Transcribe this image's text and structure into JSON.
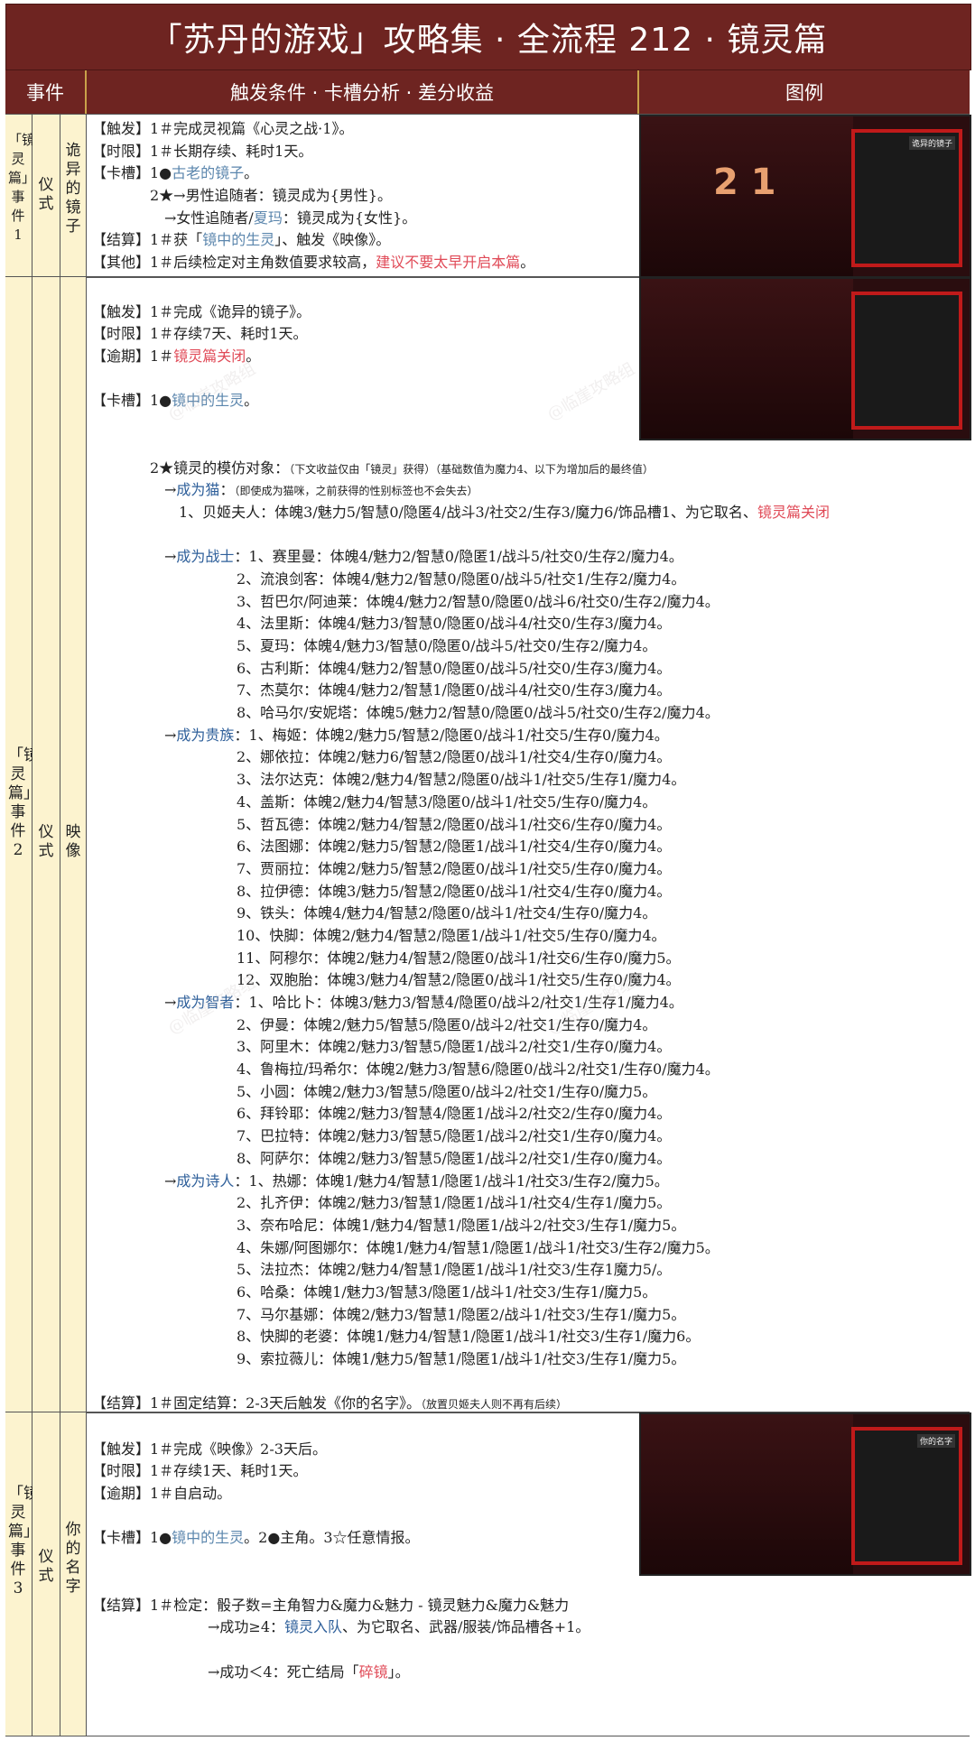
{
  "title": "「苏丹的游戏」攻略集 · 全流程 212 · 镜灵篇",
  "headers": {
    "event": "事件",
    "content": "触发条件 · 卡槽分析 · 差分收益",
    "figure": "图例"
  },
  "rows": [
    {
      "col1": "「镜灵篇」事件1",
      "col2": "仪式",
      "col3": "诡异的镜子",
      "lines": [
        {
          "pre": "【触发】1＃完成灵视篇《心灵之战·1》。"
        },
        {
          "pre": "【时限】1＃长期存续、耗时1天。"
        },
        {
          "pre": "【卡槽】1●",
          "hl": "古老的镜子",
          "hlc": "blue",
          "post": "。"
        },
        {
          "pre": "　　　　2★→男性追随者：镜灵成为{男性}。"
        },
        {
          "pre": "　　　　　→女性追随者/",
          "hl": "夏玛",
          "hlc": "blue",
          "post": "：镜灵成为{女性}。"
        },
        {
          "pre": "【结算】1＃获「",
          "hl": "镜中的生灵",
          "hlc": "blue",
          "post": "」、触发《映像》。"
        },
        {
          "pre": "【其他】1＃后续检定对主角数值要求较高，",
          "hl": "建议不要太早开启本篇",
          "hlc": "red",
          "post": "。"
        }
      ]
    },
    {
      "col1": "「镜灵篇」事件2",
      "col2": "仪式",
      "col3": "映像",
      "lines": [
        {
          "pre": ""
        },
        {
          "pre": "【触发】1＃完成《诡异的镜子》。"
        },
        {
          "pre": "【时限】1＃存续7天、耗时1天。"
        },
        {
          "pre": "【逾期】1＃",
          "hl": "镜灵篇关闭",
          "hlc": "red",
          "post": "。"
        },
        {
          "pre": ""
        },
        {
          "pre": "【卡槽】1●",
          "hl": "镜中的生灵",
          "hlc": "blue",
          "post": "。"
        },
        {
          "pre": ""
        },
        {
          "pre": ""
        },
        {
          "pre": "　　　　2★镜灵的模仿对象：",
          "small": "（下文收益仅由「镜灵」获得）（基础数值为魔力4、以下为增加后的最终值）"
        },
        {
          "pre": "　　　　　→",
          "hl": "成为猫",
          "hlc": "dblue",
          "post": "：",
          "small": "（即使成为猫咪，之前获得的性别标签也不会失去）"
        },
        {
          "pre": "　　　　　　1、贝姬夫人：体魄3/魅力5/智慧0/隐匿4/战斗3/社交2/生存3/魔力6/饰品槽1、为它取名、",
          "hl2": "镜灵篇关闭"
        },
        {
          "pre": ""
        },
        {
          "pre": "　　　　　→",
          "hl": "成为战士",
          "hlc": "dblue",
          "post": "：1、赛里曼：体魄4/魅力2/智慧0/隐匿1/战斗5/社交0/生存2/魔力4。"
        },
        {
          "pre": "　　　　　　　　　　2、流浪剑客：体魄4/魅力2/智慧0/隐匿0/战斗5/社交1/生存2/魔力4。"
        },
        {
          "pre": "　　　　　　　　　　3、哲巴尔/阿迪莱：体魄4/魅力2/智慧0/隐匿0/战斗6/社交0/生存2/魔力4。"
        },
        {
          "pre": "　　　　　　　　　　4、法里斯：体魄4/魅力3/智慧0/隐匿0/战斗4/社交0/生存3/魔力4。"
        },
        {
          "pre": "　　　　　　　　　　5、夏玛：体魄4/魅力3/智慧0/隐匿0/战斗5/社交0/生存2/魔力4。"
        },
        {
          "pre": "　　　　　　　　　　6、古利斯：体魄4/魅力2/智慧0/隐匿0/战斗5/社交0/生存3/魔力4。"
        },
        {
          "pre": "　　　　　　　　　　7、杰莫尔：体魄4/魅力2/智慧1/隐匿0/战斗4/社交0/生存3/魔力4。"
        },
        {
          "pre": "　　　　　　　　　　8、哈马尔/安妮塔：体魄5/魅力2/智慧0/隐匿0/战斗5/社交0/生存2/魔力4。"
        },
        {
          "pre": "　　　　　→",
          "hl": "成为贵族",
          "hlc": "dblue",
          "post": "：1、梅姬：体魄2/魅力5/智慧2/隐匿0/战斗1/社交5/生存0/魔力4。"
        },
        {
          "pre": "　　　　　　　　　　2、娜依拉：体魄2/魅力6/智慧2/隐匿0/战斗1/社交4/生存0/魔力4。"
        },
        {
          "pre": "　　　　　　　　　　3、法尔达克：体魄2/魅力4/智慧2/隐匿0/战斗1/社交5/生存1/魔力4。"
        },
        {
          "pre": "　　　　　　　　　　4、盖斯：体魄2/魅力4/智慧3/隐匿0/战斗1/社交5/生存0/魔力4。"
        },
        {
          "pre": "　　　　　　　　　　5、哲瓦德：体魄2/魅力4/智慧2/隐匿0/战斗1/社交6/生存0/魔力4。"
        },
        {
          "pre": "　　　　　　　　　　6、法图娜：体魄2/魅力5/智慧2/隐匿1/战斗1/社交4/生存0/魔力4。"
        },
        {
          "pre": "　　　　　　　　　　7、贾丽拉：体魄2/魅力5/智慧2/隐匿0/战斗1/社交5/生存0/魔力4。"
        },
        {
          "pre": "　　　　　　　　　　8、拉伊德：体魄3/魅力5/智慧2/隐匿0/战斗1/社交4/生存0/魔力4。"
        },
        {
          "pre": "　　　　　　　　　　9、铁头：体魄4/魅力4/智慧2/隐匿0/战斗1/社交4/生存0/魔力4。"
        },
        {
          "pre": "　　　　　　　　　　10、快脚：体魄2/魅力4/智慧2/隐匿1/战斗1/社交5/生存0/魔力4。"
        },
        {
          "pre": "　　　　　　　　　　11、阿穆尔：体魄2/魅力4/智慧2/隐匿0/战斗1/社交6/生存0/魔力5。"
        },
        {
          "pre": "　　　　　　　　　　12、双胞胎：体魄3/魅力4/智慧2/隐匿0/战斗1/社交5/生存0/魔力4。"
        },
        {
          "pre": "　　　　　→",
          "hl": "成为智者",
          "hlc": "dblue",
          "post": "：1、哈比卜：体魄3/魅力3/智慧4/隐匿0/战斗2/社交1/生存1/魔力4。"
        },
        {
          "pre": "　　　　　　　　　　2、伊曼：体魄2/魅力5/智慧5/隐匿0/战斗2/社交1/生存0/魔力4。"
        },
        {
          "pre": "　　　　　　　　　　3、阿里木：体魄2/魅力3/智慧5/隐匿1/战斗2/社交1/生存0/魔力4。"
        },
        {
          "pre": "　　　　　　　　　　4、鲁梅拉/玛希尔：体魄2/魅力3/智慧6/隐匿0/战斗2/社交1/生存0/魔力4。"
        },
        {
          "pre": "　　　　　　　　　　5、小圆：体魄2/魅力3/智慧5/隐匿0/战斗2/社交1/生存0/魔力5。"
        },
        {
          "pre": "　　　　　　　　　　6、拜铃耶：体魄2/魅力3/智慧4/隐匿1/战斗2/社交2/生存0/魔力4。"
        },
        {
          "pre": "　　　　　　　　　　7、巴拉特：体魄2/魅力3/智慧5/隐匿1/战斗2/社交1/生存0/魔力4。"
        },
        {
          "pre": "　　　　　　　　　　8、阿萨尔：体魄2/魅力3/智慧5/隐匿1/战斗2/社交1/生存0/魔力4。"
        },
        {
          "pre": "　　　　　→",
          "hl": "成为诗人",
          "hlc": "dblue",
          "post": "：1、热娜：体魄1/魅力4/智慧1/隐匿1/战斗1/社交3/生存2/魔力5。"
        },
        {
          "pre": "　　　　　　　　　　2、扎齐伊：体魄2/魅力3/智慧1/隐匿1/战斗1/社交4/生存1/魔力5。"
        },
        {
          "pre": "　　　　　　　　　　3、奈布哈尼：体魄1/魅力4/智慧1/隐匿1/战斗2/社交3/生存1/魔力5。"
        },
        {
          "pre": "　　　　　　　　　　4、朱娜/阿图娜尔：体魄1/魅力4/智慧1/隐匿1/战斗1/社交3/生存2/魔力5。"
        },
        {
          "pre": "　　　　　　　　　　5、法拉杰：体魄2/魅力4/智慧1/隐匿1/战斗1/社交3/生存1魔力5/。"
        },
        {
          "pre": "　　　　　　　　　　6、哈桑：体魄1/魅力3/智慧3/隐匿1/战斗1/社交3/生存1/魔力5。"
        },
        {
          "pre": "　　　　　　　　　　7、马尔基娜：体魄2/魅力3/智慧1/隐匿2/战斗1/社交3/生存1/魔力5。"
        },
        {
          "pre": "　　　　　　　　　　8、快脚的老婆：体魄1/魅力4/智慧1/隐匿1/战斗1/社交3/生存1/魔力6。"
        },
        {
          "pre": "　　　　　　　　　　9、索拉薇儿：体魄1/魅力5/智慧1/隐匿1/战斗1/社交3/生存1/魔力5。"
        },
        {
          "pre": ""
        },
        {
          "pre": "【结算】1＃固定结算：2-3天后触发《你的名字》。",
          "small": "（放置贝姬夫人则不再有后续）"
        }
      ]
    },
    {
      "col1": "「镜灵篇」事件3",
      "col2": "仪式",
      "col3": "你的名字",
      "lines": [
        {
          "pre": ""
        },
        {
          "pre": "【触发】1＃完成《映像》2-3天后。"
        },
        {
          "pre": "【时限】1＃存续1天、耗时1天。"
        },
        {
          "pre": "【逾期】1＃自启动。"
        },
        {
          "pre": ""
        },
        {
          "pre": "【卡槽】1●",
          "hl": "镜中的生灵",
          "hlc": "blue",
          "post": "。2●主角。3☆任意情报。"
        },
        {
          "pre": ""
        },
        {
          "pre": ""
        },
        {
          "pre": "【结算】1＃检定：骰子数=主角智力&魔力&魅力 - 镜灵魅力&魔力&魅力"
        },
        {
          "pre": "　　　　　　　　→成功≥4：",
          "hl": "镜灵入队",
          "hlc": "dblue",
          "post": "、为它取名、武器/服装/饰品槽各+1。"
        },
        {
          "pre": ""
        },
        {
          "pre": "　　　　　　　　→成功＜4：死亡结局「",
          "hl": "碎镜",
          "hlc": "red",
          "post": "」。"
        }
      ]
    }
  ],
  "figures": [
    {
      "tag": "诡异的镜子",
      "numbers": "2 1"
    },
    {
      "tag": ""
    },
    {
      "tag": "你的名字"
    }
  ],
  "watermark": "@临崖攻略组"
}
